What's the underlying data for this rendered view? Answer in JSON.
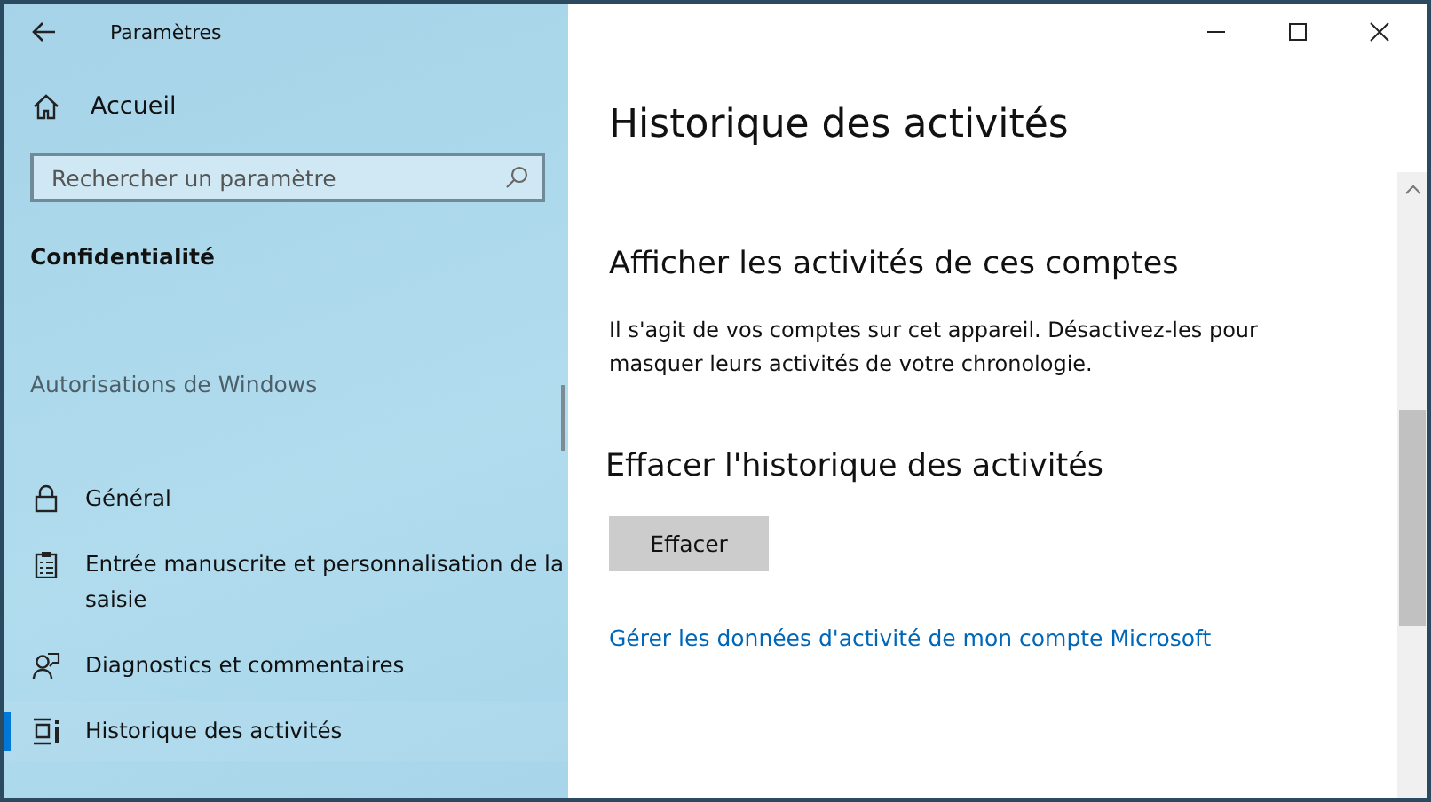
{
  "window": {
    "title": "Paramètres"
  },
  "sidebar": {
    "home": "Accueil",
    "search": {
      "placeholder": "Rechercher un paramètre"
    },
    "section": "Confidentialité",
    "group": "Autorisations de Windows",
    "items": [
      {
        "label": "Général",
        "kind": "lock",
        "selected": false
      },
      {
        "label": "Entrée manuscrite et personnalisation de la saisie",
        "kind": "clipboard",
        "selected": false
      },
      {
        "label": "Diagnostics et commentaires",
        "kind": "feedback",
        "selected": false
      },
      {
        "label": "Historique des activités",
        "kind": "timeline",
        "selected": true
      }
    ]
  },
  "page": {
    "title": "Historique des activités",
    "accounts": {
      "heading": "Afficher les activités de ces comptes",
      "text": "Il s'agit de vos comptes sur cet appareil. Désactivez-les pour masquer leurs activités de votre chronologie."
    },
    "clear": {
      "heading": "Effacer l'historique des activités",
      "button": "Effacer"
    },
    "link": "Gérer les données d'activité de mon compte Microsoft"
  }
}
